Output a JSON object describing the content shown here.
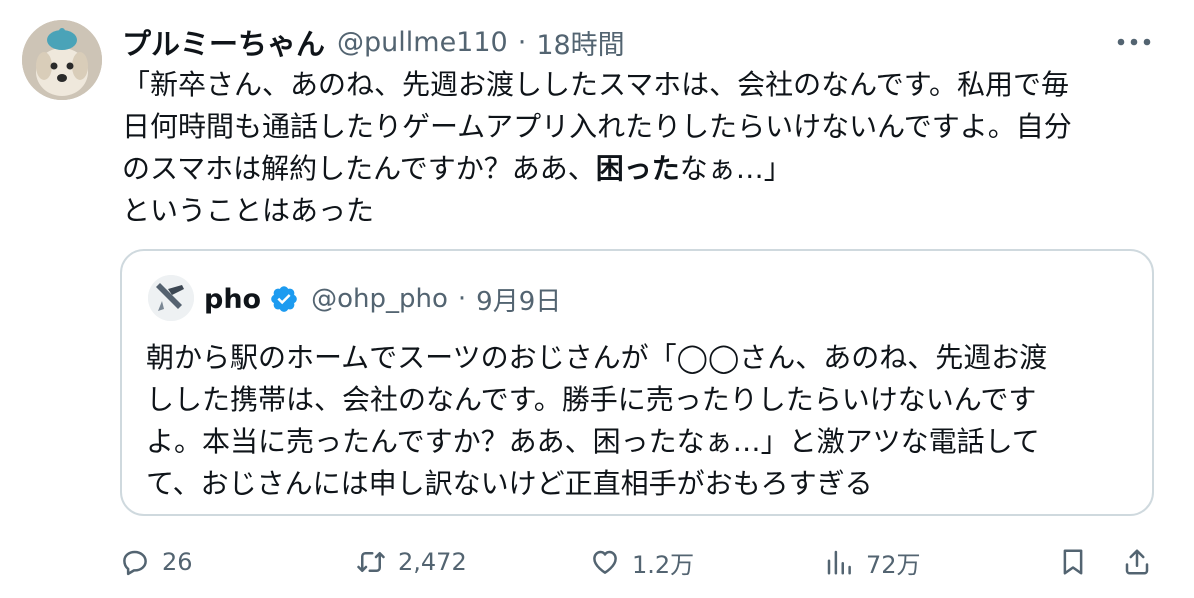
{
  "tweet": {
    "display_name": "プルミーちゃん",
    "handle": "@pullme110",
    "separator": "·",
    "time": "18時間",
    "lines": [
      "「新卒さん、あのね、先週お渡ししたスマホは、会社のなんです。私用で毎",
      "日何時間も通話したりゲームアプリ入れたりしたらいけないんですよ。自分"
    ],
    "line3_before": "のスマホは解約したんですか？ああ、",
    "line3_bold": "困った",
    "line3_after": "なぁ…」",
    "line4": "ということはあった"
  },
  "quote": {
    "display_name": "pho",
    "handle": "@ohp_pho",
    "separator": "·",
    "date": "9月9日",
    "lines": [
      "朝から駅のホームでスーツのおじさんが「◯◯さん、あのね、先週お渡",
      "しした携帯は、会社のなんです。勝手に売ったりしたらいけないんです",
      "よ。本当に売ったんですか？ああ、困ったなぁ…」と激アツな電話して",
      "て、おじさんには申し訳ないけど正直相手がおもろすぎる"
    ]
  },
  "actions": {
    "replies": "26",
    "retweets": "2,472",
    "likes": "1.2万",
    "views": "72万"
  },
  "icons": {
    "more": "more-dots-icon",
    "verified": "verified-badge-icon",
    "reply": "reply-icon",
    "retweet": "retweet-icon",
    "like": "heart-icon",
    "views": "views-icon",
    "bookmark": "bookmark-icon",
    "share": "share-icon"
  },
  "colors": {
    "text": "#0f1419",
    "secondary": "#536471",
    "border": "#cfd9de",
    "verified": "#1d9bf0"
  }
}
